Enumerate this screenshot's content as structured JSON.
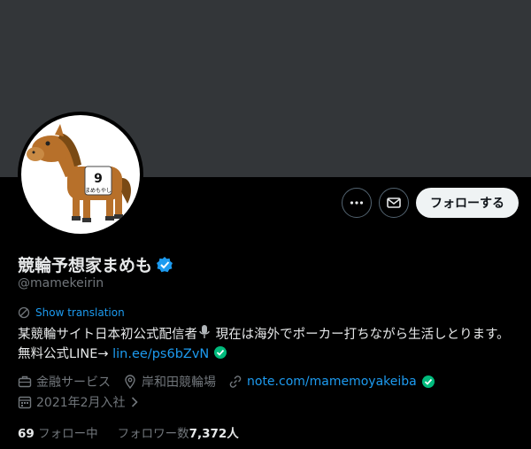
{
  "profile": {
    "display_name": "競輪予想家まめも",
    "handle": "@mamekeirin",
    "avatar_text": "9",
    "avatar_bib_text": "まめもやし"
  },
  "actions": {
    "follow_label": "フォローする",
    "more_icon": "more-icon",
    "message_icon": "envelope-icon"
  },
  "translate": {
    "label": "Show translation"
  },
  "bio": {
    "text_1": "某競輪サイト日本初公式配信者",
    "text_2": "現在は海外でポーカー打ちながら生活しとります。無料公式LINE→ ",
    "link": "lin.ee/ps6bZvN"
  },
  "meta": {
    "category": "金融サービス",
    "location": "岸和田競輪場",
    "website": "note.com/mamemoyakeiba",
    "joined": "2021年2月入社"
  },
  "stats": {
    "following_count": "69",
    "following_label": "フォロー中",
    "followers_label": "フォロワー数",
    "followers_count": "7,372人"
  },
  "colors": {
    "accent": "#1d9bf0",
    "verified": "#1d9bf0",
    "link_verified": "#00ba7c",
    "banner": "#333639"
  }
}
